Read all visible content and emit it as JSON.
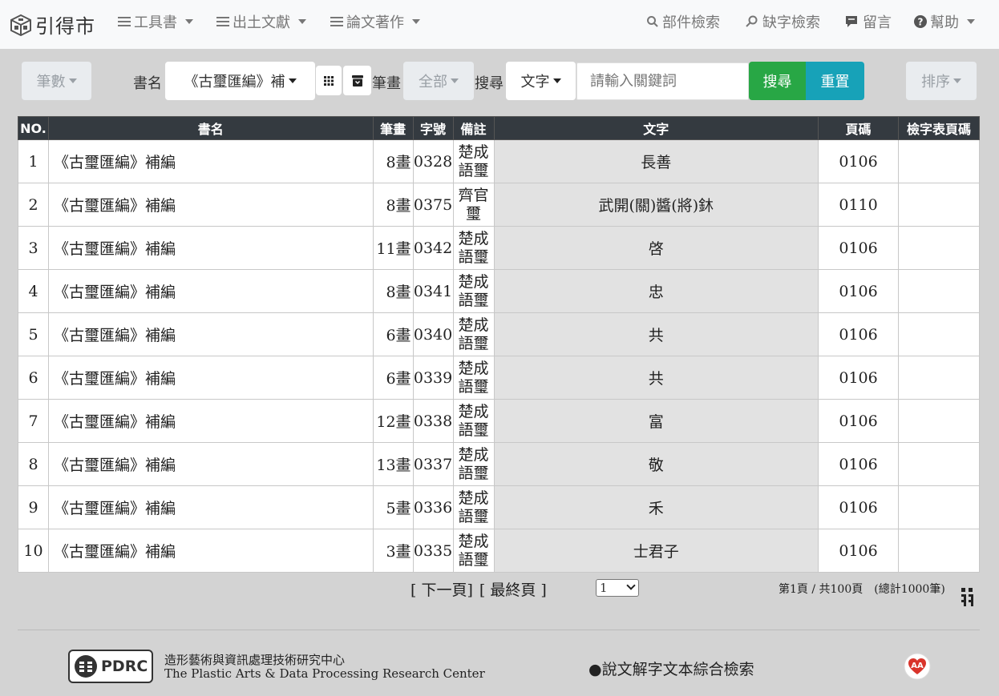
{
  "nav": {
    "brand": "引得市",
    "menus": [
      "工具書",
      "出土文獻",
      "論文著作"
    ],
    "right": [
      "部件檢索",
      "缺字檢索",
      "留言",
      "幫助"
    ]
  },
  "toolbar": {
    "count_btn": "筆數",
    "book_label": "書名",
    "book_value": "《古璽匯編》補",
    "strokes_label": "筆畫",
    "strokes_value": "全部",
    "search_label": "搜尋",
    "search_type": "文字",
    "search_placeholder": "請輸入關鍵詞",
    "search_btn": "搜尋",
    "reset_btn": "重置",
    "sort_btn": "排序"
  },
  "table": {
    "headers": [
      "NO.",
      "書名",
      "筆畫",
      "字號",
      "備註",
      "文字",
      "頁碼",
      "檢字表頁碼"
    ],
    "rows": [
      {
        "no": "1",
        "book": "《古璽匯編》補編",
        "strokes": "8畫",
        "num": "0328",
        "note1": "楚成",
        "note2": "語璽",
        "text": "長善",
        "page": "0106",
        "idx": ""
      },
      {
        "no": "2",
        "book": "《古璽匯編》補編",
        "strokes": "8畫",
        "num": "0375",
        "note1": "齊官",
        "note2": "璽",
        "text": "武開(關)醬(將)鈢",
        "page": "0110",
        "idx": ""
      },
      {
        "no": "3",
        "book": "《古璽匯編》補編",
        "strokes": "11畫",
        "num": "0342",
        "note1": "楚成",
        "note2": "語璽",
        "text": "啓",
        "page": "0106",
        "idx": ""
      },
      {
        "no": "4",
        "book": "《古璽匯編》補編",
        "strokes": "8畫",
        "num": "0341",
        "note1": "楚成",
        "note2": "語璽",
        "text": "忠",
        "page": "0106",
        "idx": ""
      },
      {
        "no": "5",
        "book": "《古璽匯編》補編",
        "strokes": "6畫",
        "num": "0340",
        "note1": "楚成",
        "note2": "語璽",
        "text": "共",
        "page": "0106",
        "idx": ""
      },
      {
        "no": "6",
        "book": "《古璽匯編》補編",
        "strokes": "6畫",
        "num": "0339",
        "note1": "楚成",
        "note2": "語璽",
        "text": "共",
        "page": "0106",
        "idx": ""
      },
      {
        "no": "7",
        "book": "《古璽匯編》補編",
        "strokes": "12畫",
        "num": "0338",
        "note1": "楚成",
        "note2": "語璽",
        "text": "富",
        "page": "0106",
        "idx": ""
      },
      {
        "no": "8",
        "book": "《古璽匯編》補編",
        "strokes": "13畫",
        "num": "0337",
        "note1": "楚成",
        "note2": "語璽",
        "text": "敬",
        "page": "0106",
        "idx": ""
      },
      {
        "no": "9",
        "book": "《古璽匯編》補編",
        "strokes": "5畫",
        "num": "0336",
        "note1": "楚成",
        "note2": "語璽",
        "text": "禾",
        "page": "0106",
        "idx": ""
      },
      {
        "no": "10",
        "book": "《古璽匯編》補編",
        "strokes": "3畫",
        "num": "0335",
        "note1": "楚成",
        "note2": "語璽",
        "text": "士君子",
        "page": "0106",
        "idx": ""
      }
    ]
  },
  "pager": {
    "next": "[ 下一頁]",
    "last": "[ 最終頁 ]",
    "current_page": "1",
    "info": "第1頁 / 共100頁　(總計1000筆)"
  },
  "footer": {
    "logo_text": "PDRC",
    "org_cn": "造形藝術與資訊處理技術研究中心",
    "org_en": "The Plastic Arts & Data Processing Research Center",
    "link": "●說文解字文本綜合檢索"
  }
}
